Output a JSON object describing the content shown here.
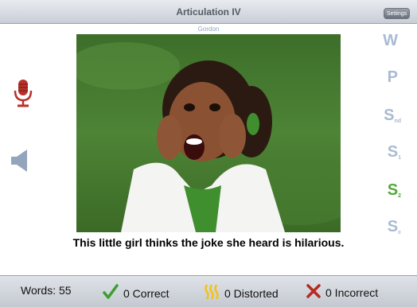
{
  "header": {
    "title": "Articulation IV",
    "settings_label": "Settings"
  },
  "student_name": "Gordon",
  "left_tools": {
    "mic_icon": "microphone-icon",
    "speaker_icon": "speaker-icon"
  },
  "levels": [
    {
      "letter": "W",
      "sub": "",
      "active": false
    },
    {
      "letter": "P",
      "sub": "",
      "active": false
    },
    {
      "letter": "S",
      "sub": "nd",
      "active": false
    },
    {
      "letter": "S",
      "sub": "1",
      "active": false
    },
    {
      "letter": "S",
      "sub": "2",
      "active": true
    },
    {
      "letter": "S",
      "sub": "c",
      "active": false
    }
  ],
  "colors": {
    "active_level": "#55a83a",
    "inactive_level": "#a9bbd3",
    "correct": "#3aa02f",
    "distorted": "#f2c21b",
    "incorrect": "#b62a22"
  },
  "caption": "This little girl thinks the joke she heard is hilarious.",
  "footer": {
    "words_label": "Words: 55",
    "correct_label": "0 Correct",
    "distorted_label": "0 Distorted",
    "incorrect_label": "0 Incorrect"
  }
}
